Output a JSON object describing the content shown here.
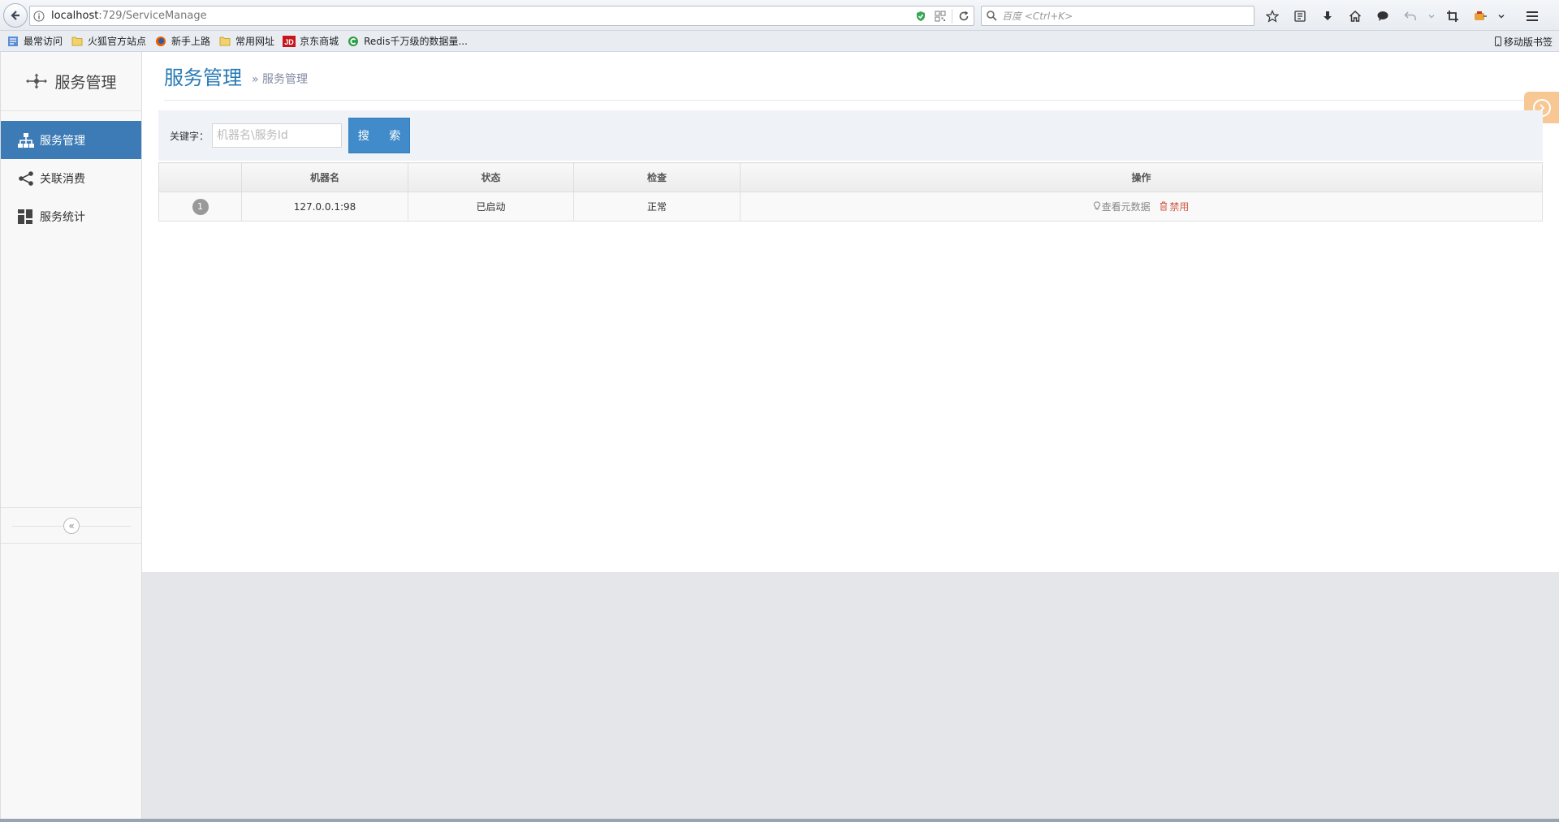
{
  "browser": {
    "url_host": "localhost",
    "url_path": ":729/ServiceManage",
    "search_placeholder": "百度 <Ctrl+K>",
    "bookmarks": [
      "最常访问",
      "火狐官方站点",
      "新手上路",
      "常用网址",
      "京东商城",
      "Redis千万级的数据量..."
    ],
    "mobile_bookmarks": "移动版书签"
  },
  "sidebar": {
    "title": "服务管理",
    "items": [
      {
        "label": "服务管理",
        "icon": "sitemap-icon",
        "active": true
      },
      {
        "label": "关联消费",
        "icon": "share-icon",
        "active": false
      },
      {
        "label": "服务统计",
        "icon": "dashboard-icon",
        "active": false
      }
    ],
    "collapse_glyph": "«"
  },
  "header": {
    "title": "服务管理",
    "breadcrumb_sep": "»",
    "breadcrumb": "服务管理"
  },
  "search": {
    "label": "关键字：",
    "placeholder": "机器名\\服务Id",
    "button": "搜 索"
  },
  "table": {
    "columns": [
      "",
      "机器名",
      "状态",
      "检查",
      "操作"
    ],
    "rows": [
      {
        "num": "1",
        "machine": "127.0.0.1:98",
        "status": "已启动",
        "check": "正常",
        "op_view": "查看元数据",
        "op_disable": "禁用"
      }
    ]
  },
  "colors": {
    "accent": "#3c7bb5",
    "title_blue": "#2679b5",
    "button_blue": "#428bca",
    "danger": "#d15b47",
    "fab": "#f8c894"
  }
}
